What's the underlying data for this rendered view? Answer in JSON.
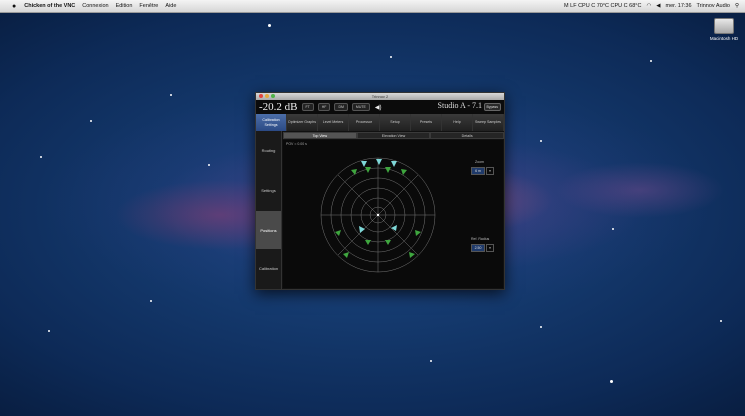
{
  "menubar": {
    "apple": "",
    "app_name": "Chicken of the VNC",
    "menus": [
      "Connexion",
      "Edition",
      "Fenêtre",
      "Aide"
    ],
    "status_text": "M LF CPU C 70°C CPU C 68°C",
    "clock": "mer. 17:36",
    "user": "Trinnov Audio"
  },
  "desktop": {
    "disk_label": "Macintosh HD"
  },
  "window": {
    "title": "Trinnov 2",
    "level": "-20.2 dB",
    "toolbar_buttons": [
      "FT",
      "HF",
      "DM",
      "MUTE"
    ],
    "speaker_glyph": "◀)",
    "preset_name": "Studio A - 7.1",
    "bypass_label": "Bypass",
    "tabs": [
      "Calibration Settings",
      "Optimizer Graphs",
      "Level Meters",
      "Processor",
      "Setup",
      "Presets",
      "Help",
      "Sweep Samples"
    ],
    "sidebar": [
      "Routing",
      "Settings",
      "Positions",
      "Calibration"
    ],
    "subtabs": [
      "Top View",
      "Elevation View",
      "Details"
    ],
    "readout": "POV = 0.00 s",
    "zoom_label": "Zoom",
    "zoom_value": "6 m",
    "ref_label": "Ref. Radius",
    "ref_value": "2.50"
  },
  "colors": {
    "accent_tab": "#3d5e9a",
    "speaker_main": "#7fd8d8",
    "speaker_other": "#3fa63f"
  }
}
